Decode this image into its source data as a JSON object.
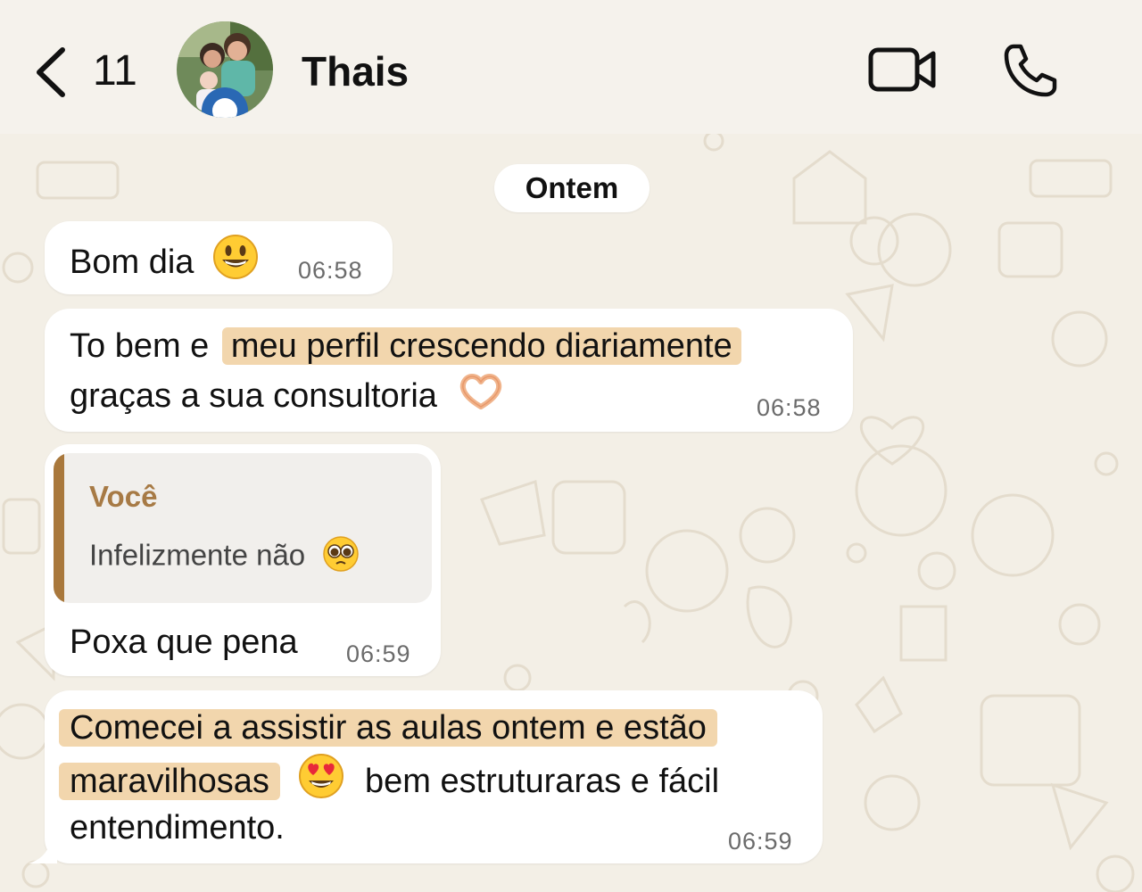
{
  "header": {
    "back_count": "11",
    "contact_name": "Thais",
    "back_icon": "chevron-left-icon",
    "video_icon": "video-camera-icon",
    "call_icon": "phone-icon"
  },
  "date_chip": "Ontem",
  "messages": [
    {
      "text": "Bom dia",
      "emoji": "grinning-face",
      "time": "06:58"
    },
    {
      "line1_plain": "To bem e",
      "line1_highlight": "meu perfil crescendo diariamente",
      "line2": "graças a sua consultoria",
      "emoji": "heart-hands",
      "time": "06:58"
    },
    {
      "quote_author": "Você",
      "quote_text": "Infelizmente não",
      "quote_emoji": "pleading-face",
      "text": "Poxa que pena",
      "time": "06:59"
    },
    {
      "line1_highlight": "Comecei a assistir as aulas ontem e estão",
      "line2_highlight": "maravilhosas",
      "line2_rest": "bem estruturaras e fácil",
      "line3": "entendimento.",
      "emoji": "heart-eyes-face",
      "time": "06:59"
    }
  ],
  "colors": {
    "background": "#f3efe6",
    "bubble": "#ffffff",
    "highlight": "#f2d6ad",
    "quote_bar": "#a9783c",
    "quote_author": "#a77a45"
  }
}
